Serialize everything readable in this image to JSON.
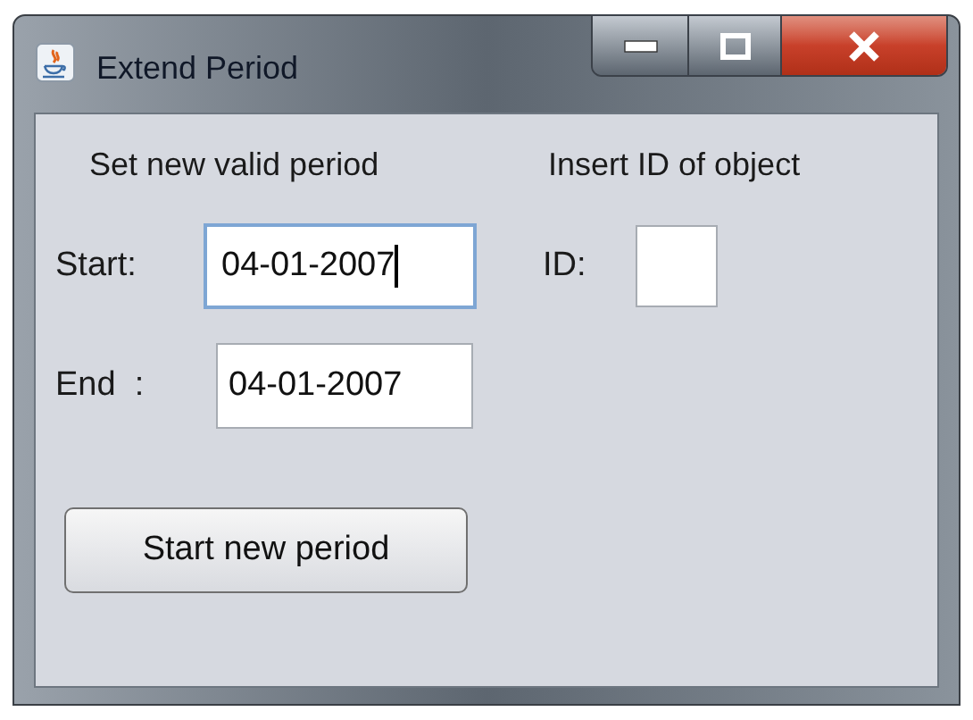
{
  "window": {
    "title": "Extend Period"
  },
  "period": {
    "heading": "Set new valid period",
    "fields": [
      {
        "label": "Start:",
        "value": "04-01-2007",
        "focused": true
      },
      {
        "label": "End  :",
        "value": "04-01-2007",
        "focused": false
      }
    ]
  },
  "object": {
    "heading": "Insert ID of object",
    "label": "ID:"
  },
  "buttons": [
    "Start new period"
  ]
}
